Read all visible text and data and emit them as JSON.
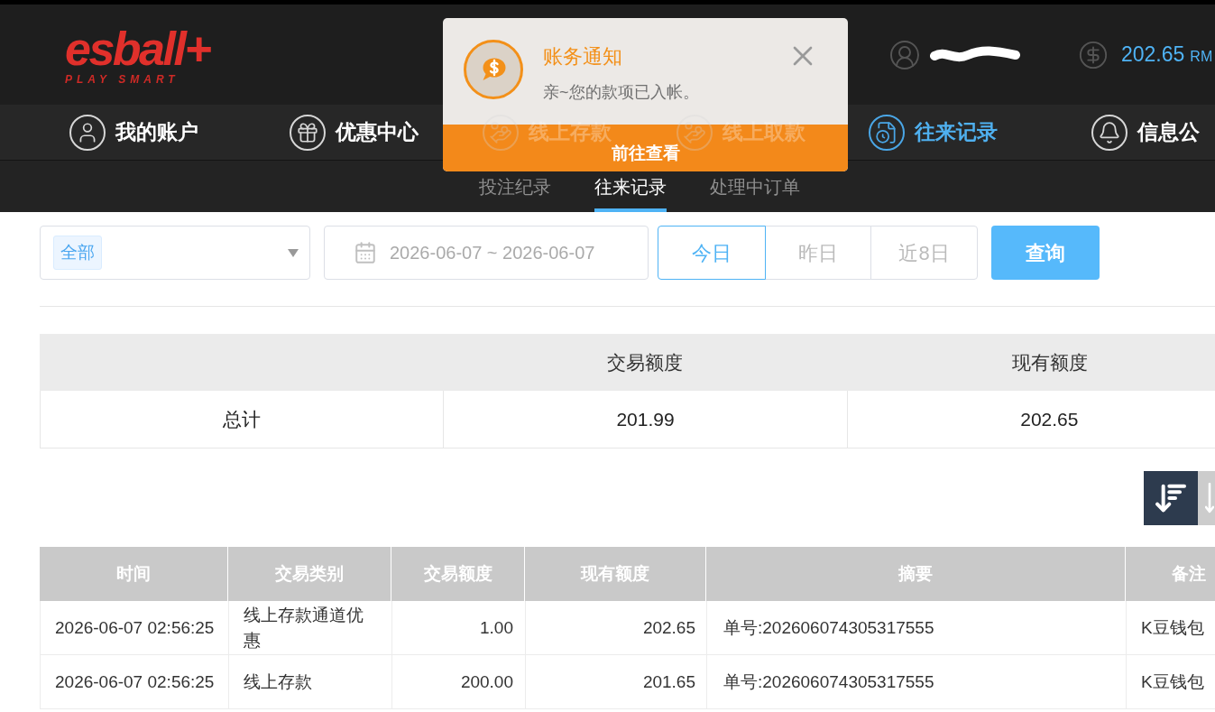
{
  "header": {
    "logo": {
      "wordmark": "esball+",
      "tagline": "PLAY SMART"
    },
    "account": {
      "redacted": true
    },
    "balance": {
      "amount": "202.65",
      "currency": "RM"
    }
  },
  "main_nav": [
    {
      "label": "我的账户",
      "selected": false
    },
    {
      "label": "优惠中心",
      "selected": false
    },
    {
      "label": "线上存款",
      "selected": false
    },
    {
      "label": "线上取款",
      "selected": false
    },
    {
      "label": "往来记录",
      "selected": true
    },
    {
      "label": "信息公",
      "selected": false
    }
  ],
  "notification": {
    "title": "账务通知",
    "message": "亲~您的款项已入帐。",
    "action": "前往查看"
  },
  "sub_tabs": [
    {
      "label": "投注纪录",
      "selected": false
    },
    {
      "label": "往来记录",
      "selected": true
    },
    {
      "label": "处理中订单",
      "selected": false
    }
  ],
  "filters": {
    "type_select": {
      "tags": [
        "全部"
      ]
    },
    "date_range": {
      "value": "2026-06-07 ~ 2026-06-07"
    },
    "quick_ranges": [
      {
        "label": "今日",
        "selected": true
      },
      {
        "label": "昨日",
        "selected": false
      },
      {
        "label": "近8日",
        "selected": false
      }
    ],
    "search_button": "查询"
  },
  "summary": {
    "columns": [
      "交易额度",
      "现有额度"
    ],
    "rows": [
      {
        "label": "总计",
        "values": [
          "201.99",
          "202.65"
        ]
      }
    ]
  },
  "sort_buttons": [
    {
      "selected": true
    },
    {
      "selected": false
    }
  ],
  "transactions": {
    "columns": [
      "时间",
      "交易类别",
      "交易额度",
      "现有额度",
      "摘要",
      "备注"
    ],
    "rows": [
      {
        "cells": [
          "2026-06-07 02:56:25",
          "线上存款通道优惠",
          "1.00",
          "202.65",
          "单号:202606074305317555",
          "K豆钱包"
        ]
      },
      {
        "cells": [
          "2026-06-07 02:56:25",
          "线上存款",
          "200.00",
          "201.65",
          "单号:202606074305317555",
          "K豆钱包"
        ]
      }
    ]
  }
}
